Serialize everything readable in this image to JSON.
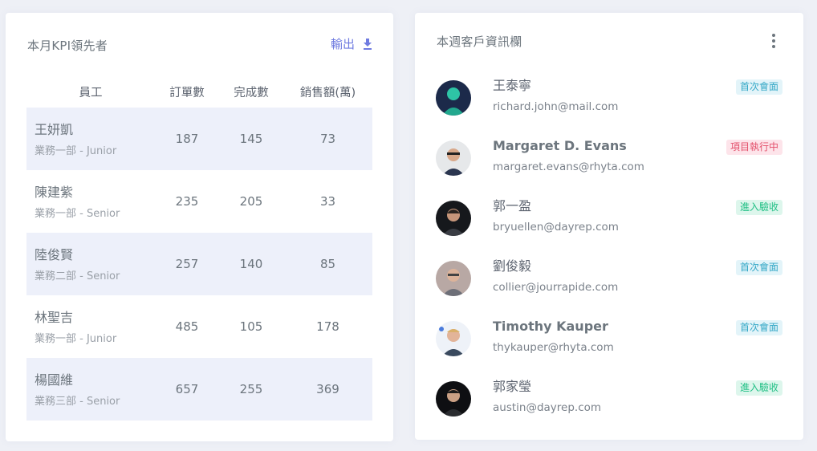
{
  "kpi": {
    "title": "本月KPI領先者",
    "export_label": "輸出",
    "columns": [
      "員工",
      "訂單數",
      "完成數",
      "銷售額(萬)"
    ],
    "rows": [
      {
        "name": "王妍凱",
        "dept": "業務一部 - Junior",
        "orders": "187",
        "completed": "145",
        "sales": "73"
      },
      {
        "name": "陳建紫",
        "dept": "業務一部 - Senior",
        "orders": "235",
        "completed": "205",
        "sales": "33"
      },
      {
        "name": "陸俊賢",
        "dept": "業務二部 - Senior",
        "orders": "257",
        "completed": "140",
        "sales": "85"
      },
      {
        "name": "林聖吉",
        "dept": "業務一部 - Junior",
        "orders": "485",
        "completed": "105",
        "sales": "178"
      },
      {
        "name": "楊國維",
        "dept": "業務三部 - Senior",
        "orders": "657",
        "completed": "255",
        "sales": "369"
      }
    ]
  },
  "clients": {
    "title": "本週客戶資訊欄",
    "items": [
      {
        "name": "王泰寧",
        "email": "richard.john@mail.com",
        "status": "首次會面",
        "status_type": "info"
      },
      {
        "name": "Margaret D. Evans",
        "email": "margaret.evans@rhyta.com",
        "status": "項目執行中",
        "status_type": "danger"
      },
      {
        "name": "郭一盈",
        "email": "bryuellen@dayrep.com",
        "status": "進入驗收",
        "status_type": "success"
      },
      {
        "name": "劉俊毅",
        "email": "collier@jourrapide.com",
        "status": "首次會面",
        "status_type": "info"
      },
      {
        "name": "Timothy Kauper",
        "email": "thykauper@rhyta.com",
        "status": "首次會面",
        "status_type": "info"
      },
      {
        "name": "郭家瑩",
        "email": "austin@dayrep.com",
        "status": "進入驗收",
        "status_type": "success"
      }
    ]
  },
  "colors": {
    "accent": "#6f7be0",
    "badge_info": "#33a7c6",
    "badge_danger": "#e3506b",
    "badge_success": "#1fbf84",
    "row_stripe": "#edf0fa"
  },
  "icons": {
    "export": "download-icon",
    "more": "more-vertical-icon"
  }
}
